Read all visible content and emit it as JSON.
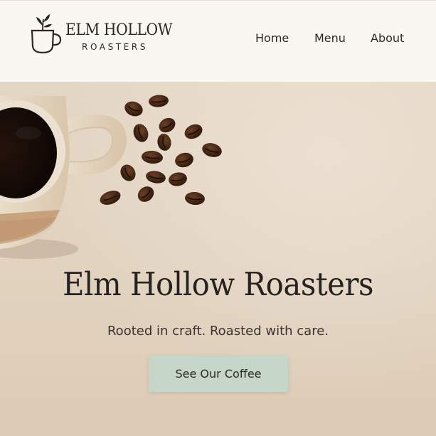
{
  "brand": {
    "title": "ELM HOLLOW",
    "subtitle": "ROASTERS",
    "logo_icon": "coffee-cup-sprout-icon"
  },
  "nav": {
    "items": [
      {
        "label": "Home"
      },
      {
        "label": "Menu"
      },
      {
        "label": "About"
      }
    ]
  },
  "hero": {
    "title": "Elm Hollow Roasters",
    "tagline": "Rooted in craft. Roasted with care.",
    "cta_label": "See Our Coffee",
    "image": "coffee-cup-and-beans"
  },
  "colors": {
    "header_bg": "#faf7f2",
    "hero_bg": "#e2d3c0",
    "cta_bg": "#c6d6c8",
    "text": "#2a2522"
  }
}
